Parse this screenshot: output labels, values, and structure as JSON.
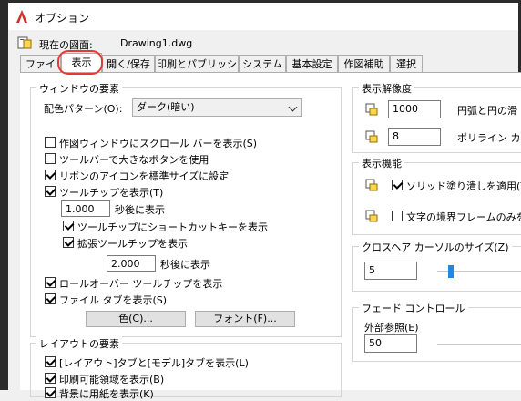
{
  "window": {
    "title": "オプション"
  },
  "current_drawing": {
    "label": "現在の図面:",
    "file": "Drawing1.dwg"
  },
  "tabs": [
    {
      "label": "ファイル"
    },
    {
      "label": "表示"
    },
    {
      "label": "開く/保存"
    },
    {
      "label": "印刷とパブリッシュ"
    },
    {
      "label": "システム"
    },
    {
      "label": "基本設定"
    },
    {
      "label": "作図補助"
    },
    {
      "label": "選択"
    }
  ],
  "window_elements": {
    "title": "ウィンドウの要素",
    "color_scheme_label": "配色パターン(O):",
    "color_scheme_value": "ダーク(暗い)",
    "checks": [
      {
        "label": "作図ウィンドウにスクロール バーを表示(S)",
        "checked": false
      },
      {
        "label": "ツールバーで大きなボタンを使用",
        "checked": false
      },
      {
        "label": "リボンのアイコンを標準サイズに設定",
        "checked": true
      },
      {
        "label": "ツールチップを表示(T)",
        "checked": true
      }
    ],
    "tooltip_delay_value": "1.000",
    "tooltip_delay_label": "秒後に表示",
    "shortcut_label": "ツールチップにショートカットキーを表示",
    "extended_label": "拡張ツールチップを表示",
    "extended_delay_value": "2.000",
    "extended_delay_label": "秒後に表示",
    "rollover_label": "ロールオーバー ツールチップを表示",
    "file_tabs_label": "ファイル タブを表示(S)",
    "color_button": "色(C)...",
    "font_button": "フォント(F)..."
  },
  "layout_elements": {
    "title": "レイアウトの要素",
    "checks": [
      {
        "label": "[レイアウト]タブと[モデル]タブを表示(L)",
        "checked": true
      },
      {
        "label": "印刷可能領域を表示(B)",
        "checked": true
      },
      {
        "label": "背景に用紙を表示(K)",
        "checked": true
      }
    ]
  },
  "display_resolution": {
    "title": "表示解像度",
    "rows": [
      {
        "value": "1000",
        "label": "円弧と円の滑"
      },
      {
        "value": "8",
        "label": "ポリライン カー"
      }
    ]
  },
  "display_performance": {
    "title": "表示機能",
    "rows": [
      {
        "label": "ソリッド塗り潰しを適用(Y)",
        "checked": true
      },
      {
        "label": "文字の境界フレームのみを",
        "checked": false
      }
    ]
  },
  "crosshair": {
    "title": "クロスヘア カーソルのサイズ(Z)",
    "value": "5"
  },
  "fade": {
    "title": "フェード コントロール",
    "xref_label": "外部参照(E)",
    "xref_value": "50"
  }
}
